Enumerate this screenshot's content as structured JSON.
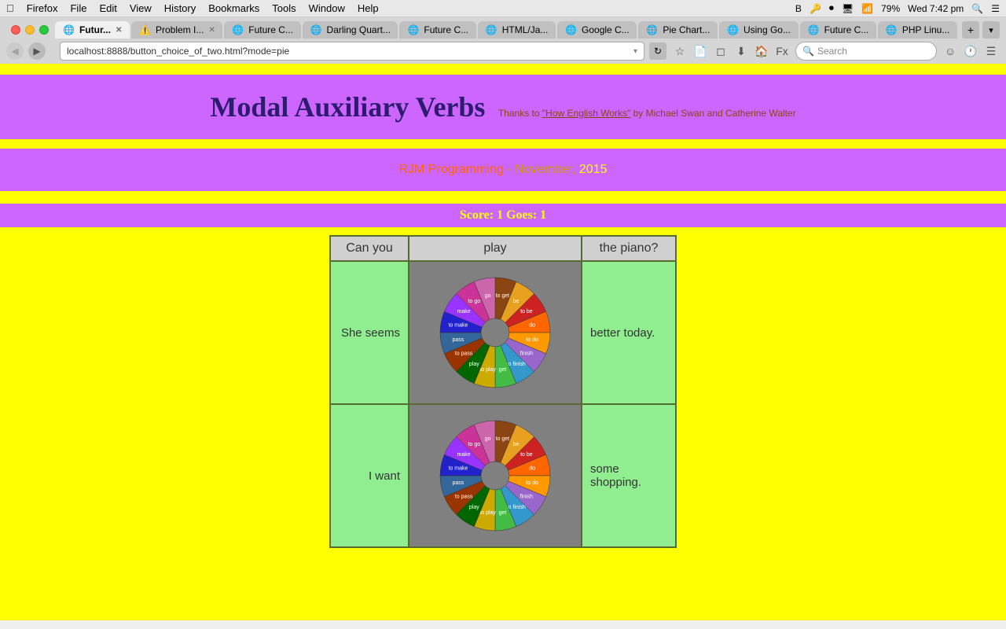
{
  "menubar": {
    "apple": "&#63743;",
    "items": [
      "Firefox",
      "File",
      "Edit",
      "View",
      "History",
      "Bookmarks",
      "Tools",
      "Window",
      "Help"
    ],
    "right": {
      "battery": "79%",
      "time": "Wed 7:42 pm"
    }
  },
  "tabs": [
    {
      "label": "Futur...",
      "active": true,
      "favicon": "🌐"
    },
    {
      "label": "Problem I...",
      "active": false,
      "favicon": "⚠️"
    },
    {
      "label": "Future C...",
      "active": false,
      "favicon": "🌐"
    },
    {
      "label": "Darling Quart...",
      "active": false,
      "favicon": "🌐"
    },
    {
      "label": "Future C...",
      "active": false,
      "favicon": "🌐"
    },
    {
      "label": "HTML/Ja...",
      "active": false,
      "favicon": "🌐"
    },
    {
      "label": "Google C...",
      "active": false,
      "favicon": "🌐"
    },
    {
      "label": "Pie Chart...",
      "active": false,
      "favicon": "🌐"
    },
    {
      "label": "Using Go...",
      "active": false,
      "favicon": "🌐"
    },
    {
      "label": "Future C...",
      "active": false,
      "favicon": "🌐"
    },
    {
      "label": "PHP Linu...",
      "active": false,
      "favicon": "🌐"
    }
  ],
  "addressbar": {
    "url": "localhost:8888/button_choice_of_two.html?mode=pie"
  },
  "searchbar": {
    "placeholder": "Search"
  },
  "page": {
    "title": "Modal Auxiliary Verbs",
    "subtitle": "Thanks to ",
    "subtitle_link": "\"How English Works\"",
    "subtitle_rest": " by Michael Swan and Catherine Walter",
    "branding": {
      "name": "RJM Programming",
      "dash": " - ",
      "month": "November,",
      "year": " 2015"
    },
    "score": "Score: 1 Goes: 1",
    "table": {
      "headers": [
        "Can you",
        "play",
        "the piano?"
      ],
      "rows": [
        {
          "left": "She seems",
          "right": "better today."
        },
        {
          "left": "I want",
          "right": "some shopping."
        }
      ]
    }
  },
  "pie": {
    "segments": [
      {
        "label": "to get",
        "color": "#8B4513",
        "startAngle": 0,
        "endAngle": 24
      },
      {
        "label": "be",
        "color": "#e8a020",
        "startAngle": 24,
        "endAngle": 48
      },
      {
        "label": "to be",
        "color": "#cc0000",
        "startAngle": 48,
        "endAngle": 72
      },
      {
        "label": "do",
        "color": "#ff6600",
        "startAngle": 72,
        "endAngle": 96
      },
      {
        "label": "to do",
        "color": "#ff9900",
        "startAngle": 96,
        "endAngle": 120
      },
      {
        "label": "finish",
        "color": "#cc66ff",
        "startAngle": 120,
        "endAngle": 144
      },
      {
        "label": "to finish",
        "color": "#0099cc",
        "startAngle": 144,
        "endAngle": 168
      },
      {
        "label": "get",
        "color": "#33cc33",
        "startAngle": 168,
        "endAngle": 192
      },
      {
        "label": "to play",
        "color": "#ffcc00",
        "startAngle": 192,
        "endAngle": 216
      },
      {
        "label": "play",
        "color": "#006600",
        "startAngle": 216,
        "endAngle": 240
      },
      {
        "label": "to pass",
        "color": "#993300",
        "startAngle": 240,
        "endAngle": 264
      },
      {
        "label": "pass",
        "color": "#336699",
        "startAngle": 264,
        "endAngle": 288
      },
      {
        "label": "to make",
        "color": "#0000cc",
        "startAngle": 288,
        "endAngle": 312
      },
      {
        "label": "make",
        "color": "#9933ff",
        "startAngle": 312,
        "endAngle": 336
      },
      {
        "label": "to go",
        "color": "#cc3399",
        "startAngle": 336,
        "endAngle": 360
      }
    ]
  }
}
